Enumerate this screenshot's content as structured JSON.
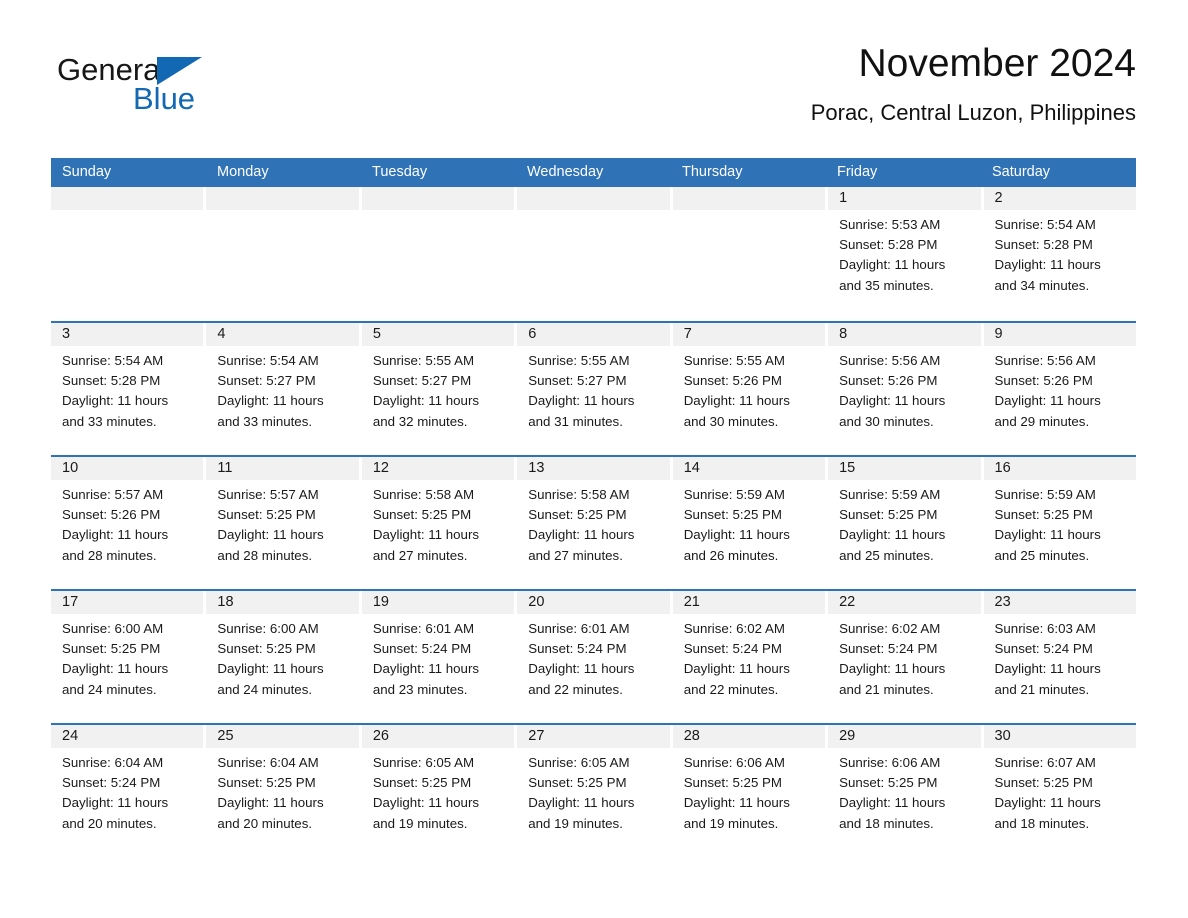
{
  "logo": {
    "word_one": "General",
    "word_two": "Blue",
    "triangle_color": "#1268B3",
    "blue_color": "#1268B3"
  },
  "header": {
    "month_title": "November 2024",
    "location": "Porac, Central Luzon, Philippines"
  },
  "theme": {
    "header_blue": "#2F72B6",
    "day_band_gray": "#F1F1F1",
    "separator_blue": "#2F72B6",
    "text_color": "#1a1a1a"
  },
  "weekday_headers": [
    "Sunday",
    "Monday",
    "Tuesday",
    "Wednesday",
    "Thursday",
    "Friday",
    "Saturday"
  ],
  "weeks": [
    [
      {
        "day": "",
        "empty": true,
        "sunrise": "",
        "sunset": "",
        "daylight_line1": "",
        "daylight_line2": ""
      },
      {
        "day": "",
        "empty": true,
        "sunrise": "",
        "sunset": "",
        "daylight_line1": "",
        "daylight_line2": ""
      },
      {
        "day": "",
        "empty": true,
        "sunrise": "",
        "sunset": "",
        "daylight_line1": "",
        "daylight_line2": ""
      },
      {
        "day": "",
        "empty": true,
        "sunrise": "",
        "sunset": "",
        "daylight_line1": "",
        "daylight_line2": ""
      },
      {
        "day": "",
        "empty": true,
        "sunrise": "",
        "sunset": "",
        "daylight_line1": "",
        "daylight_line2": ""
      },
      {
        "day": "1",
        "empty": false,
        "sunrise": "Sunrise: 5:53 AM",
        "sunset": "Sunset: 5:28 PM",
        "daylight_line1": "Daylight: 11 hours",
        "daylight_line2": "and 35 minutes."
      },
      {
        "day": "2",
        "empty": false,
        "sunrise": "Sunrise: 5:54 AM",
        "sunset": "Sunset: 5:28 PM",
        "daylight_line1": "Daylight: 11 hours",
        "daylight_line2": "and 34 minutes."
      }
    ],
    [
      {
        "day": "3",
        "empty": false,
        "sunrise": "Sunrise: 5:54 AM",
        "sunset": "Sunset: 5:28 PM",
        "daylight_line1": "Daylight: 11 hours",
        "daylight_line2": "and 33 minutes."
      },
      {
        "day": "4",
        "empty": false,
        "sunrise": "Sunrise: 5:54 AM",
        "sunset": "Sunset: 5:27 PM",
        "daylight_line1": "Daylight: 11 hours",
        "daylight_line2": "and 33 minutes."
      },
      {
        "day": "5",
        "empty": false,
        "sunrise": "Sunrise: 5:55 AM",
        "sunset": "Sunset: 5:27 PM",
        "daylight_line1": "Daylight: 11 hours",
        "daylight_line2": "and 32 minutes."
      },
      {
        "day": "6",
        "empty": false,
        "sunrise": "Sunrise: 5:55 AM",
        "sunset": "Sunset: 5:27 PM",
        "daylight_line1": "Daylight: 11 hours",
        "daylight_line2": "and 31 minutes."
      },
      {
        "day": "7",
        "empty": false,
        "sunrise": "Sunrise: 5:55 AM",
        "sunset": "Sunset: 5:26 PM",
        "daylight_line1": "Daylight: 11 hours",
        "daylight_line2": "and 30 minutes."
      },
      {
        "day": "8",
        "empty": false,
        "sunrise": "Sunrise: 5:56 AM",
        "sunset": "Sunset: 5:26 PM",
        "daylight_line1": "Daylight: 11 hours",
        "daylight_line2": "and 30 minutes."
      },
      {
        "day": "9",
        "empty": false,
        "sunrise": "Sunrise: 5:56 AM",
        "sunset": "Sunset: 5:26 PM",
        "daylight_line1": "Daylight: 11 hours",
        "daylight_line2": "and 29 minutes."
      }
    ],
    [
      {
        "day": "10",
        "empty": false,
        "sunrise": "Sunrise: 5:57 AM",
        "sunset": "Sunset: 5:26 PM",
        "daylight_line1": "Daylight: 11 hours",
        "daylight_line2": "and 28 minutes."
      },
      {
        "day": "11",
        "empty": false,
        "sunrise": "Sunrise: 5:57 AM",
        "sunset": "Sunset: 5:25 PM",
        "daylight_line1": "Daylight: 11 hours",
        "daylight_line2": "and 28 minutes."
      },
      {
        "day": "12",
        "empty": false,
        "sunrise": "Sunrise: 5:58 AM",
        "sunset": "Sunset: 5:25 PM",
        "daylight_line1": "Daylight: 11 hours",
        "daylight_line2": "and 27 minutes."
      },
      {
        "day": "13",
        "empty": false,
        "sunrise": "Sunrise: 5:58 AM",
        "sunset": "Sunset: 5:25 PM",
        "daylight_line1": "Daylight: 11 hours",
        "daylight_line2": "and 27 minutes."
      },
      {
        "day": "14",
        "empty": false,
        "sunrise": "Sunrise: 5:59 AM",
        "sunset": "Sunset: 5:25 PM",
        "daylight_line1": "Daylight: 11 hours",
        "daylight_line2": "and 26 minutes."
      },
      {
        "day": "15",
        "empty": false,
        "sunrise": "Sunrise: 5:59 AM",
        "sunset": "Sunset: 5:25 PM",
        "daylight_line1": "Daylight: 11 hours",
        "daylight_line2": "and 25 minutes."
      },
      {
        "day": "16",
        "empty": false,
        "sunrise": "Sunrise: 5:59 AM",
        "sunset": "Sunset: 5:25 PM",
        "daylight_line1": "Daylight: 11 hours",
        "daylight_line2": "and 25 minutes."
      }
    ],
    [
      {
        "day": "17",
        "empty": false,
        "sunrise": "Sunrise: 6:00 AM",
        "sunset": "Sunset: 5:25 PM",
        "daylight_line1": "Daylight: 11 hours",
        "daylight_line2": "and 24 minutes."
      },
      {
        "day": "18",
        "empty": false,
        "sunrise": "Sunrise: 6:00 AM",
        "sunset": "Sunset: 5:25 PM",
        "daylight_line1": "Daylight: 11 hours",
        "daylight_line2": "and 24 minutes."
      },
      {
        "day": "19",
        "empty": false,
        "sunrise": "Sunrise: 6:01 AM",
        "sunset": "Sunset: 5:24 PM",
        "daylight_line1": "Daylight: 11 hours",
        "daylight_line2": "and 23 minutes."
      },
      {
        "day": "20",
        "empty": false,
        "sunrise": "Sunrise: 6:01 AM",
        "sunset": "Sunset: 5:24 PM",
        "daylight_line1": "Daylight: 11 hours",
        "daylight_line2": "and 22 minutes."
      },
      {
        "day": "21",
        "empty": false,
        "sunrise": "Sunrise: 6:02 AM",
        "sunset": "Sunset: 5:24 PM",
        "daylight_line1": "Daylight: 11 hours",
        "daylight_line2": "and 22 minutes."
      },
      {
        "day": "22",
        "empty": false,
        "sunrise": "Sunrise: 6:02 AM",
        "sunset": "Sunset: 5:24 PM",
        "daylight_line1": "Daylight: 11 hours",
        "daylight_line2": "and 21 minutes."
      },
      {
        "day": "23",
        "empty": false,
        "sunrise": "Sunrise: 6:03 AM",
        "sunset": "Sunset: 5:24 PM",
        "daylight_line1": "Daylight: 11 hours",
        "daylight_line2": "and 21 minutes."
      }
    ],
    [
      {
        "day": "24",
        "empty": false,
        "sunrise": "Sunrise: 6:04 AM",
        "sunset": "Sunset: 5:24 PM",
        "daylight_line1": "Daylight: 11 hours",
        "daylight_line2": "and 20 minutes."
      },
      {
        "day": "25",
        "empty": false,
        "sunrise": "Sunrise: 6:04 AM",
        "sunset": "Sunset: 5:25 PM",
        "daylight_line1": "Daylight: 11 hours",
        "daylight_line2": "and 20 minutes."
      },
      {
        "day": "26",
        "empty": false,
        "sunrise": "Sunrise: 6:05 AM",
        "sunset": "Sunset: 5:25 PM",
        "daylight_line1": "Daylight: 11 hours",
        "daylight_line2": "and 19 minutes."
      },
      {
        "day": "27",
        "empty": false,
        "sunrise": "Sunrise: 6:05 AM",
        "sunset": "Sunset: 5:25 PM",
        "daylight_line1": "Daylight: 11 hours",
        "daylight_line2": "and 19 minutes."
      },
      {
        "day": "28",
        "empty": false,
        "sunrise": "Sunrise: 6:06 AM",
        "sunset": "Sunset: 5:25 PM",
        "daylight_line1": "Daylight: 11 hours",
        "daylight_line2": "and 19 minutes."
      },
      {
        "day": "29",
        "empty": false,
        "sunrise": "Sunrise: 6:06 AM",
        "sunset": "Sunset: 5:25 PM",
        "daylight_line1": "Daylight: 11 hours",
        "daylight_line2": "and 18 minutes."
      },
      {
        "day": "30",
        "empty": false,
        "sunrise": "Sunrise: 6:07 AM",
        "sunset": "Sunset: 5:25 PM",
        "daylight_line1": "Daylight: 11 hours",
        "daylight_line2": "and 18 minutes."
      }
    ]
  ]
}
